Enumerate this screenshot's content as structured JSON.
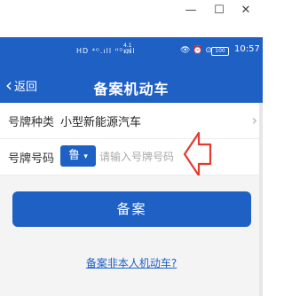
{
  "window": {
    "min": "—",
    "max": "☐",
    "close": "✕"
  },
  "status_bar": {
    "signal": "HD ⁴ᴳ.ıll ᴴᴰ.ıll",
    "speed": "4.1\nK/s",
    "icons": "👁 ⏰ ⊙",
    "battery": "100",
    "time": "10:57"
  },
  "navbar": {
    "back_label": "返回",
    "title": "备案机动车"
  },
  "form": {
    "plate_type_label": "号牌种类",
    "plate_type_value": "小型新能源汽车",
    "plate_number_label": "号牌号码",
    "province": "鲁",
    "plate_placeholder": "请输入号牌号码"
  },
  "actions": {
    "submit_label": "备案",
    "link_label": "备案非本人机动车?"
  },
  "colors": {
    "primary": "#1f60c4",
    "annotation": "#e33b2f"
  }
}
